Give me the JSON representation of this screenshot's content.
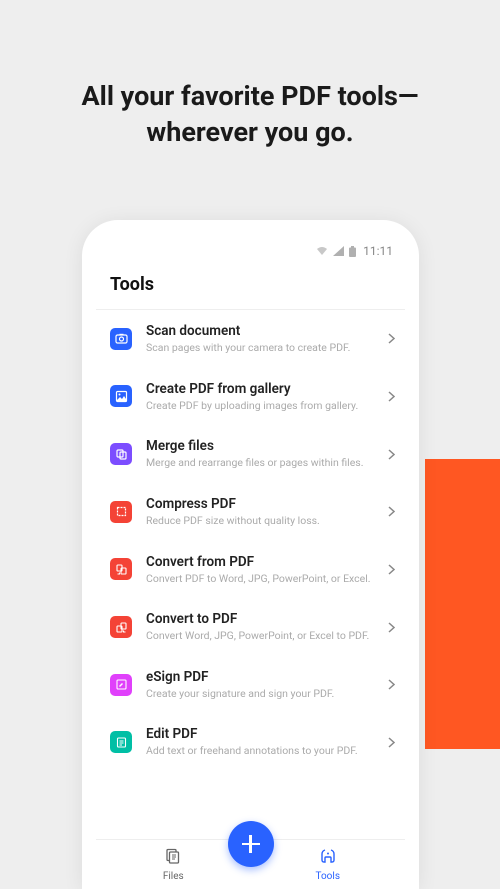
{
  "headline": "All your favorite PDF tools—wherever you go.",
  "statusBar": {
    "time": "11:11"
  },
  "pageTitle": "Tools",
  "tools": [
    {
      "icon": "camera-icon",
      "color": "#2962ff",
      "title": "Scan document",
      "sub": "Scan pages with your camera to create PDF."
    },
    {
      "icon": "image-icon",
      "color": "#2962ff",
      "title": "Create PDF from gallery",
      "sub": "Create PDF by uploading images from gallery."
    },
    {
      "icon": "merge-icon",
      "color": "#7c4dff",
      "title": "Merge files",
      "sub": "Merge and rearrange files or pages within files."
    },
    {
      "icon": "compress-icon",
      "color": "#f44336",
      "title": "Compress PDF",
      "sub": "Reduce PDF size without quality loss."
    },
    {
      "icon": "convert-from-icon",
      "color": "#f44336",
      "title": "Convert from PDF",
      "sub": "Convert PDF to Word, JPG, PowerPoint, or Excel."
    },
    {
      "icon": "convert-to-icon",
      "color": "#f44336",
      "title": "Convert to PDF",
      "sub": "Convert Word, JPG, PowerPoint, or Excel to PDF."
    },
    {
      "icon": "esign-icon",
      "color": "#e040fb",
      "title": "eSign PDF",
      "sub": "Create your signature and sign your PDF."
    },
    {
      "icon": "edit-icon",
      "color": "#00bfa5",
      "title": "Edit PDF",
      "sub": "Add text or freehand annotations to your PDF."
    }
  ],
  "bottomNav": {
    "files": "Files",
    "tools": "Tools"
  }
}
